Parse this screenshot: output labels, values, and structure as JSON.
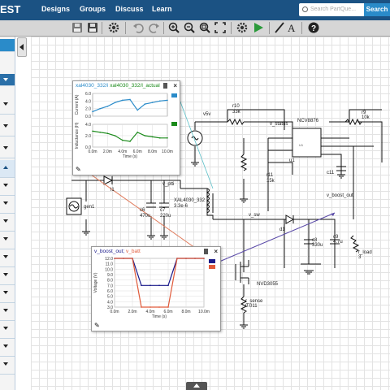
{
  "nav": {
    "logo": "EST",
    "links": [
      "Designs",
      "Groups",
      "Discuss",
      "Learn"
    ],
    "search_placeholder": "Search PartQue...",
    "search_button": "Search"
  },
  "toolbar": {
    "tools": [
      "save",
      "save-as",
      "gear",
      "undo",
      "redo",
      "zoom-in",
      "zoom-out",
      "zoom-fit",
      "zoom-select",
      "settings",
      "run",
      "draw-wire",
      "add-text",
      "help"
    ]
  },
  "circuit": {
    "labels": {
      "v_batt": "v_batt",
      "v_ptti": "v_ptti",
      "l1": "l1",
      "gen1": "gen1",
      "c6": "c6",
      "c6v": "470u",
      "c7": "c7",
      "c7v": "220u",
      "inductor": "XAL4030_332",
      "inductor_v": "3.3e-6",
      "v5v": "v5v",
      "r10": "r10",
      "r10v": "33k",
      "r9": "r9",
      "r9v": "10k",
      "v_status": "v_status",
      "ic": "NCV8876",
      "u1": "u1",
      "r11": "r11",
      "r11v": "15k",
      "c11": "c11",
      "v_boost_out": "v_boost_out",
      "v_sw": "v_sw",
      "d1": "d1",
      "c8": "c8",
      "c8v": "330u",
      "c9": "c9",
      "c9v": "4.7u",
      "r_load": "r_load",
      "r_load_v": "3",
      "mosfet": "NVD3055",
      "r_sense": "r_sense",
      "r_sense_v": "0.011"
    }
  },
  "plot1": {
    "title_a": "xal4030_332/i",
    "title_b": "xal4030_332/l_actual",
    "colors": [
      "#2a8bc9",
      "#1a8a1a"
    ],
    "chart_data": [
      {
        "type": "line",
        "title": "",
        "ylabel": "Current (A)",
        "xlabel": "",
        "x": [
          0,
          1,
          2,
          3,
          4,
          5,
          6,
          7,
          8,
          9,
          10
        ],
        "series": [
          {
            "name": "xal4030_332/i",
            "values": [
              1.2,
              2.0,
              2.6,
              3.6,
              4.2,
              4.4,
              1.6,
              3.2,
              3.6,
              4.0,
              4.2
            ]
          }
        ],
        "yticks": [
          "6.0",
          "4.0",
          "2.0",
          "0.0"
        ],
        "ylim": [
          0,
          6
        ]
      },
      {
        "type": "line",
        "title": "",
        "ylabel": "Inductance (H)",
        "xlabel": "Time (s)",
        "x": [
          0,
          1,
          2,
          3,
          4,
          5,
          6,
          7,
          8,
          9,
          10
        ],
        "series": [
          {
            "name": "xal4030_332/l_actual",
            "values": [
              2.8,
              2.6,
              2.4,
              2.0,
              1.2,
              1.0,
              2.6,
              2.0,
              1.8,
              1.6,
              1.6
            ]
          }
        ],
        "yticks": [
          "4.0",
          "2.0",
          "0.0"
        ],
        "xticks": [
          "0.0m",
          "2.0m",
          "4.0m",
          "6.0m",
          "8.0m",
          "10.0m"
        ],
        "ylim": [
          0,
          4
        ]
      }
    ]
  },
  "plot2": {
    "title_a": "v_boost_out",
    "title_b": "v_batt",
    "colors": [
      "#1a1a8a",
      "#e05a3a"
    ],
    "chart_data": {
      "type": "line",
      "title": "",
      "ylabel": "Voltage (V)",
      "xlabel": "Time (s)",
      "x": [
        0,
        1,
        2,
        3,
        4,
        5,
        6,
        7,
        8,
        9,
        10
      ],
      "series": [
        {
          "name": "v_boost_out",
          "values": [
            12.0,
            12.0,
            12.0,
            7.0,
            7.0,
            7.0,
            7.0,
            12.0,
            12.0,
            12.0,
            12.0
          ]
        },
        {
          "name": "v_batt",
          "values": [
            12.0,
            12.0,
            12.0,
            3.0,
            3.0,
            3.0,
            3.0,
            12.0,
            12.0,
            12.0,
            12.0
          ]
        }
      ],
      "yticks": [
        "12.0",
        "11.0",
        "10.0",
        "9.0",
        "8.0",
        "7.0",
        "6.0",
        "5.0",
        "4.0",
        "3.0"
      ],
      "xticks": [
        "0.0m",
        "2.0m",
        "4.0m",
        "6.0m",
        "8.0m",
        "10.0m"
      ],
      "ylim": [
        3,
        12
      ]
    }
  }
}
